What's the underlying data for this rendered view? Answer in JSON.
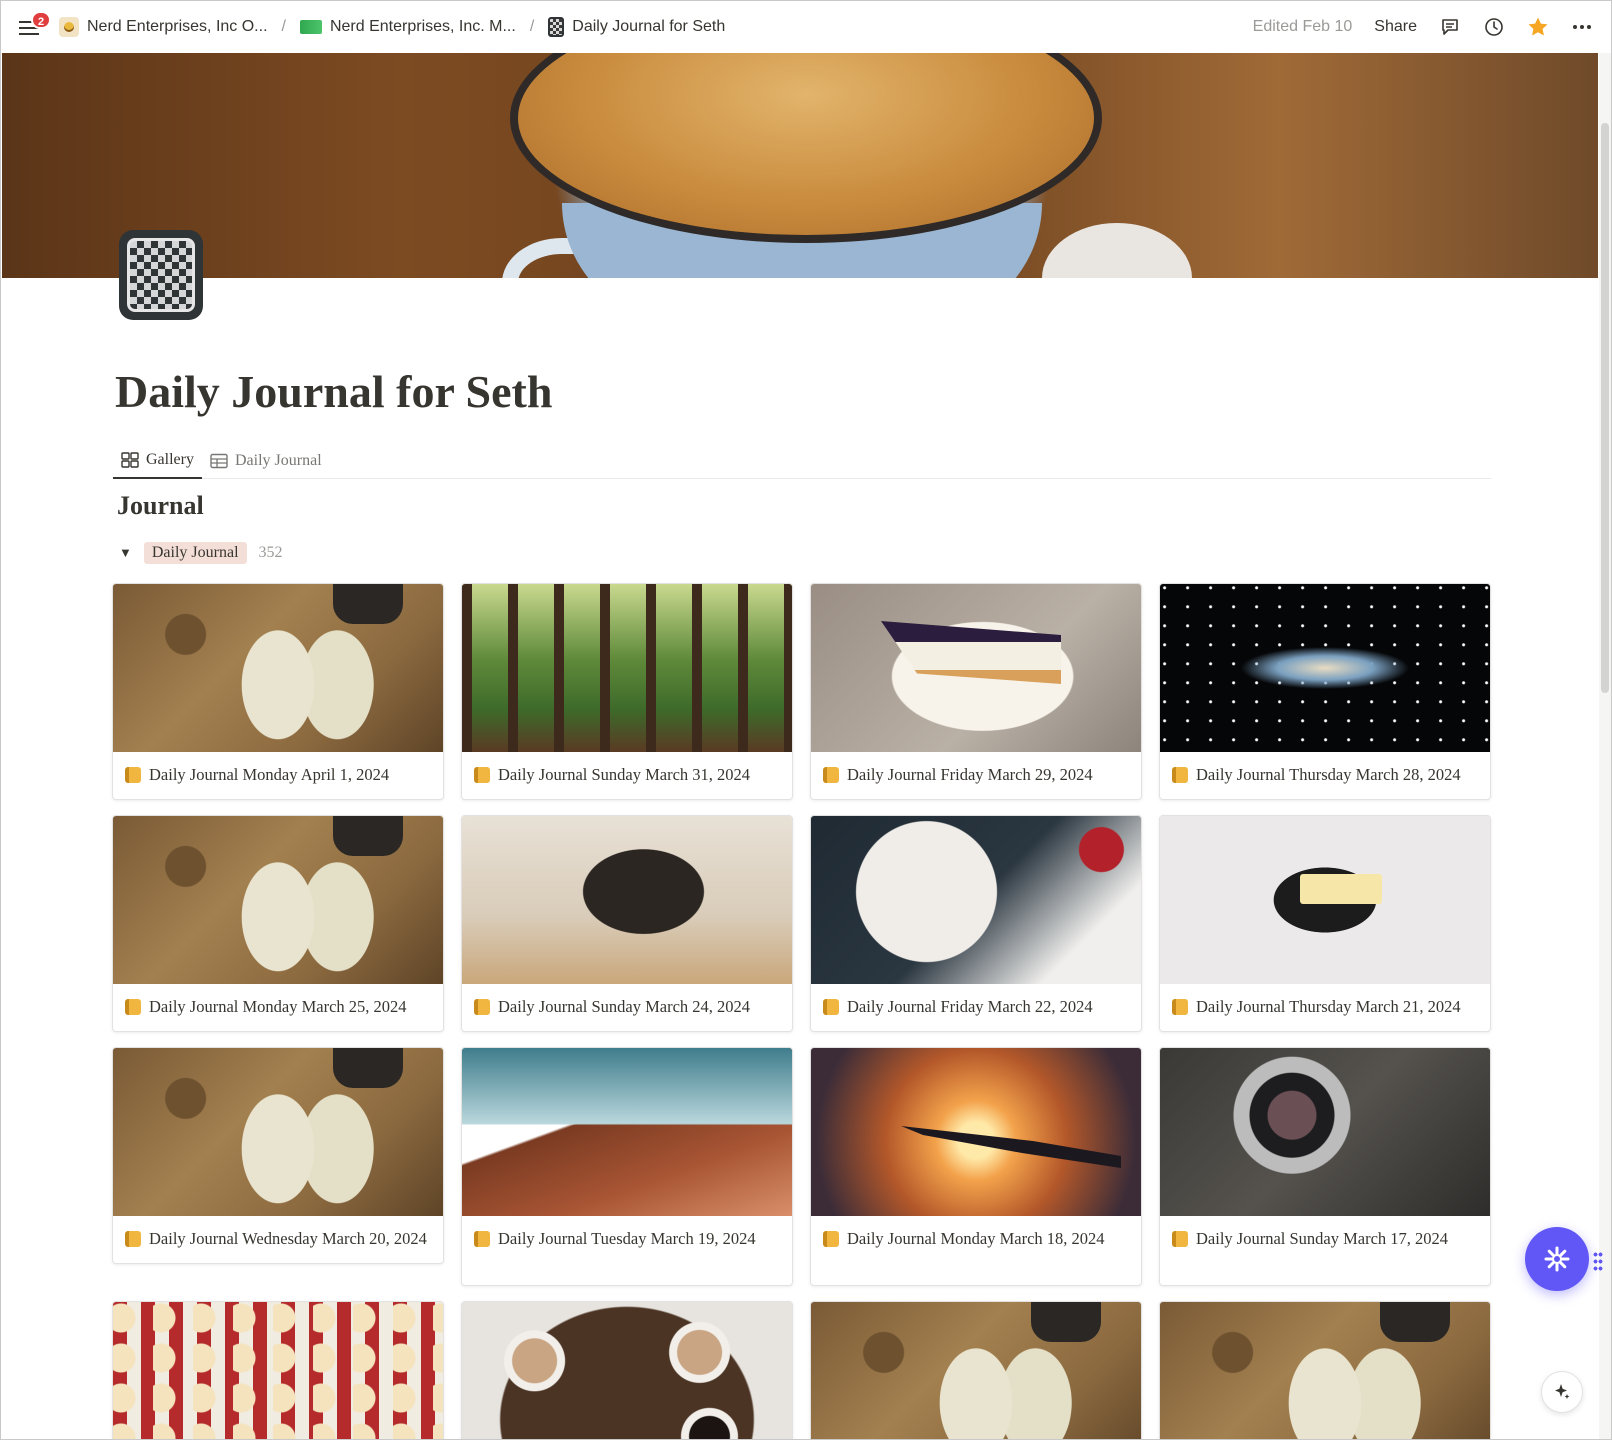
{
  "topbar": {
    "notification_count": "2",
    "breadcrumbs": [
      {
        "label": "Nerd Enterprises, Inc O..."
      },
      {
        "label": "Nerd Enterprises, Inc. M..."
      },
      {
        "label": "Daily Journal for Seth"
      }
    ],
    "separator": "/",
    "edited": "Edited Feb 10",
    "share": "Share"
  },
  "page": {
    "title": "Daily Journal for Seth"
  },
  "tabs": [
    {
      "label": "Gallery",
      "active": true
    },
    {
      "label": "Daily Journal",
      "active": false
    }
  ],
  "section": {
    "title": "Journal",
    "group_label": "Daily Journal",
    "group_count": "352"
  },
  "cards": [
    {
      "title": "Daily Journal Monday April 1, 2024",
      "image": "map-notebook"
    },
    {
      "title": "Daily Journal Sunday March 31, 2024",
      "image": "forest"
    },
    {
      "title": "Daily Journal Friday March 29, 2024",
      "image": "blueberry-cheesecake"
    },
    {
      "title": "Daily Journal Thursday March 28, 2024",
      "image": "galaxy"
    },
    {
      "title": "Daily Journal Monday March 25, 2024",
      "image": "map-notebook"
    },
    {
      "title": "Daily Journal Sunday March 24, 2024",
      "image": "pug"
    },
    {
      "title": "Daily Journal Friday March 22, 2024",
      "image": "oreo-cake"
    },
    {
      "title": "Daily Journal Thursday March 21, 2024",
      "image": "cassette"
    },
    {
      "title": "Daily Journal Wednesday March 20, 2024",
      "image": "map-notebook"
    },
    {
      "title": "Daily Journal Tuesday March 19, 2024",
      "image": "desert-canyon"
    },
    {
      "title": "Daily Journal Monday March 18, 2024",
      "image": "airplane-sunset"
    },
    {
      "title": "Daily Journal Sunday March 17, 2024",
      "image": "vintage-camera"
    },
    {
      "title": "",
      "image": "popcorn"
    },
    {
      "title": "",
      "image": "coffee-cups"
    },
    {
      "title": "",
      "image": "map-notebook"
    },
    {
      "title": "",
      "image": "map-notebook"
    }
  ],
  "colors": {
    "accent_fab": "#6157f6",
    "favorite_star": "#f5a623",
    "group_pill_bg": "#f4dfd8",
    "notification": "#e03e3e"
  }
}
